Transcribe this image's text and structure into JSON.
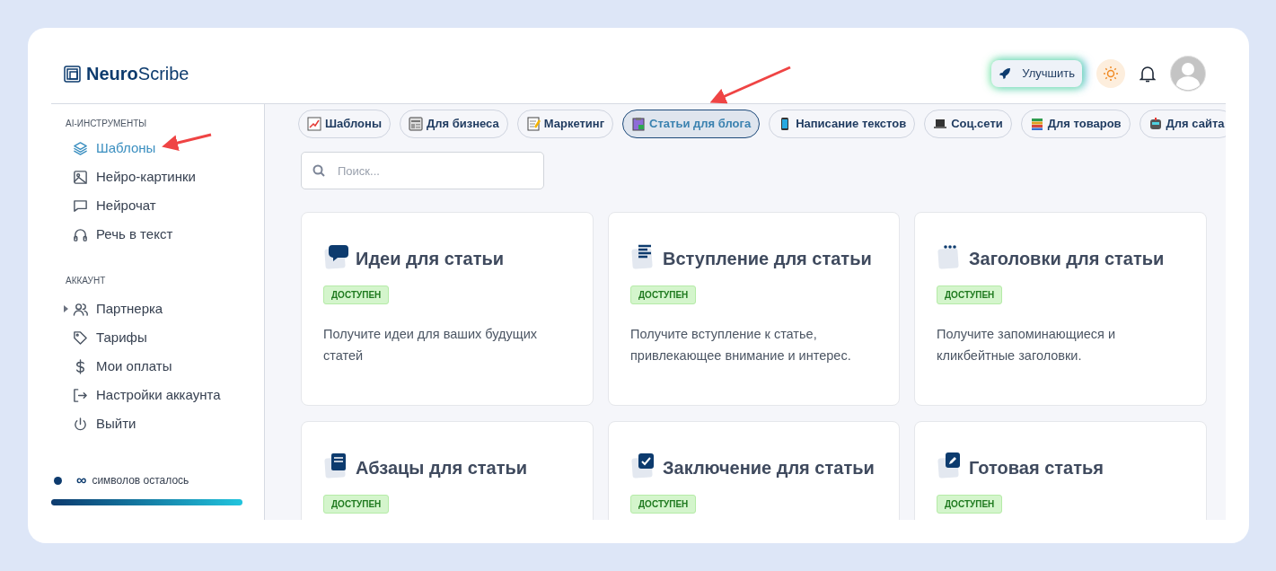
{
  "header": {
    "logo": "**Neuro**Scribe",
    "upgrade_button": "Улучшить"
  },
  "sidebar": {
    "sections": [
      {
        "title": "AI-ИНСТРУМЕНТЫ",
        "items": [
          {
            "label": "Шаблоны",
            "selected": true
          },
          {
            "label": "Нейро-картинки",
            "selected": false
          },
          {
            "label": "Нейрочат",
            "selected": false
          },
          {
            "label": "Речь в текст",
            "selected": false
          }
        ]
      },
      {
        "title": "АККАУНТ",
        "items": [
          {
            "label": "Партнерка",
            "selected": false,
            "expanded": false
          },
          {
            "label": "Тарифы",
            "selected": false
          },
          {
            "label": "Мои оплаты",
            "selected": false
          },
          {
            "label": "Настройки аккаунта",
            "selected": false
          },
          {
            "label": "Выйти",
            "selected": false
          }
        ]
      }
    ],
    "credits": {
      "symbol": "∞",
      "text": "символов осталось",
      "level": 1
    }
  },
  "categories": [
    {
      "label": "Шаблоны",
      "selected": false
    },
    {
      "label": "Для бизнеса",
      "selected": false
    },
    {
      "label": "Маркетинг",
      "selected": false
    },
    {
      "label": "Статьи для блога",
      "selected": true
    },
    {
      "label": "Написание текстов",
      "selected": false
    },
    {
      "label": "Соц.сети",
      "selected": false
    },
    {
      "label": "Для товаров",
      "selected": false
    },
    {
      "label": "Для сайта",
      "selected": false
    }
  ],
  "search": {
    "placeholder": "Поиск..."
  },
  "templates": [
    {
      "title": "Идеи для статьи",
      "badge": "ДОСТУПЕН",
      "description": "Получите идеи для ваших будущих статей"
    },
    {
      "title": "Вступление для статьи",
      "badge": "ДОСТУПЕН",
      "description": "Получите вступление к статье, привлекающее внимание и интерес."
    },
    {
      "title": "Заголовки для статьи",
      "badge": "ДОСТУПЕН",
      "description": "Получите запоминающиеся и кликбейтные заголовки."
    },
    {
      "title": "Абзацы для статьи",
      "badge": "ДОСТУПЕН"
    },
    {
      "title": "Заключение для статьи",
      "badge": "ДОСТУПЕН"
    },
    {
      "title": "Готовая статья",
      "badge": "ДОСТУПЕН"
    }
  ]
}
